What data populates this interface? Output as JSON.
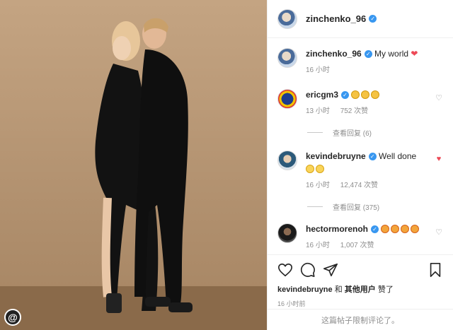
{
  "post": {
    "author": "zinchenko_96",
    "caption": "My world",
    "caption_time": "16 小时"
  },
  "comments": [
    {
      "user": "ericgm3",
      "emoji_count": 3,
      "emoji_kind": "clap",
      "time": "13 小时",
      "likes": "752 次赞",
      "replies": "查看回复 (6)",
      "liked": false
    },
    {
      "user": "kevindebruyne",
      "text": "Well done",
      "emoji_count": 2,
      "emoji_kind": "laugh",
      "time": "16 小时",
      "likes": "12,474 次赞",
      "replies": "查看回复 (375)",
      "liked": true
    },
    {
      "user": "hectormorenoh",
      "emoji_count": 4,
      "emoji_kind": "star",
      "time": "16 小时",
      "likes": "1,007 次赞",
      "liked": false
    }
  ],
  "liked_by": {
    "first": "kevindebruyne",
    "and": "和",
    "others": "其他用户",
    "suffix": "赞了"
  },
  "post_time": "16 小时前",
  "comments_limited": "这篇帖子限制评论了。",
  "colors": {
    "accent": "#3897f0",
    "heart": "#ed4956",
    "photo_bg": "#b89876"
  }
}
